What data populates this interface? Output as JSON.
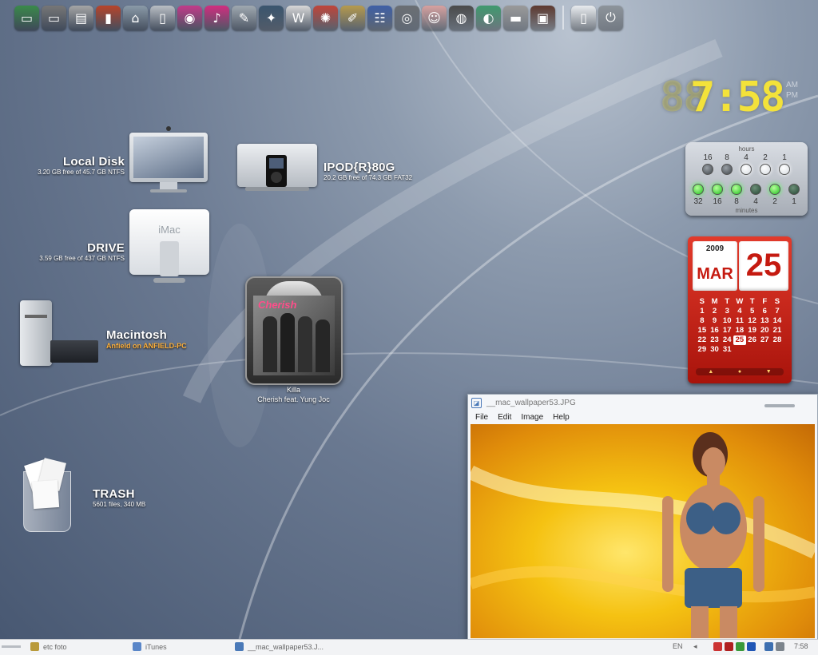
{
  "dock": {
    "icons": [
      {
        "name": "computer-icon",
        "color": "#3a8a4a",
        "glyph": "▭"
      },
      {
        "name": "laptop-icon",
        "color": "#777777",
        "glyph": "▭"
      },
      {
        "name": "printer-icon",
        "color": "#a5a5a5",
        "glyph": "▤"
      },
      {
        "name": "books-icon",
        "color": "#b8442a",
        "glyph": "▮"
      },
      {
        "name": "network-icon",
        "color": "#8a9aa8",
        "glyph": "⌂"
      },
      {
        "name": "mac-pro-icon",
        "color": "#b9bec4",
        "glyph": "▯"
      },
      {
        "name": "ipod-icon",
        "color": "#c33a8a",
        "glyph": "◉"
      },
      {
        "name": "music-icon",
        "color": "#d22d80",
        "glyph": "♪"
      },
      {
        "name": "tools-icon",
        "color": "#9fa8b0",
        "glyph": "✎"
      },
      {
        "name": "compass-icon",
        "color": "#3a556e",
        "glyph": "✦"
      },
      {
        "name": "wikipedia-icon",
        "color": "#d8d8d8",
        "glyph": "W"
      },
      {
        "name": "fox-icon",
        "color": "#c0453a",
        "glyph": "✺"
      },
      {
        "name": "notes-icon",
        "color": "#b59a4d",
        "glyph": "✐"
      },
      {
        "name": "users-icon",
        "color": "#3e5fa6",
        "glyph": "☷"
      },
      {
        "name": "camera-icon",
        "color": "#6b6f74",
        "glyph": "◎"
      },
      {
        "name": "girl-icon",
        "color": "#d7a1a0",
        "glyph": "☺"
      },
      {
        "name": "speaker-icon",
        "color": "#4a4a4a",
        "glyph": "◍"
      },
      {
        "name": "dvd-icon",
        "color": "#3f9a6e",
        "glyph": "◐"
      },
      {
        "name": "scanner-icon",
        "color": "#9a9a9a",
        "glyph": "▬"
      },
      {
        "name": "safe-icon",
        "color": "#5e3a30",
        "glyph": "▣"
      }
    ],
    "trailing_icons": [
      {
        "name": "wii-icon",
        "color": "#e9ecef",
        "glyph": "▯"
      },
      {
        "name": "power-icon",
        "color": "#8d949b",
        "glyph": "⏻"
      }
    ]
  },
  "desktop": {
    "local_disk": {
      "name": "Local Disk",
      "info": "3.20 GB free of 45.7 GB NTFS"
    },
    "ipod": {
      "name": "IPOD{R}80G",
      "info": "20.2 GB free of 74.3 GB FAT32"
    },
    "drive": {
      "name": "DRIVE",
      "info": "3.59 GB free of 437 GB NTFS"
    },
    "macintosh": {
      "name": "Macintosh",
      "info": "Anfield on ANFIELD-PC"
    },
    "trash": {
      "name": "TRASH",
      "info": "5601 files, 340 MB"
    },
    "imac_label": "iMac"
  },
  "album": {
    "title": "Killa",
    "artist": "Cherish feat. Yung Joc",
    "art_text": "Cherish"
  },
  "clock": {
    "ghost": "88",
    "hour": "7",
    "sep": ":",
    "minutes": "58",
    "am": "AM",
    "pm": "PM"
  },
  "binary_clock": {
    "hours_label": "hours",
    "minutes_label": "minutes",
    "hours": [
      {
        "v": "16",
        "on": false
      },
      {
        "v": "8",
        "on": false
      },
      {
        "v": "4",
        "on": true
      },
      {
        "v": "2",
        "on": true
      },
      {
        "v": "1",
        "on": true
      }
    ],
    "minutes": [
      {
        "v": "32",
        "on": true
      },
      {
        "v": "16",
        "on": true
      },
      {
        "v": "8",
        "on": true
      },
      {
        "v": "4",
        "on": false
      },
      {
        "v": "2",
        "on": true
      },
      {
        "v": "1",
        "on": false
      }
    ]
  },
  "calendar": {
    "year": "2009",
    "month": "MAR",
    "day": "25",
    "weekdays": [
      "S",
      "M",
      "T",
      "W",
      "T",
      "F",
      "S"
    ],
    "weeks": [
      [
        "1",
        "2",
        "3",
        "4",
        "5",
        "6",
        "7"
      ],
      [
        "8",
        "9",
        "10",
        "11",
        "12",
        "13",
        "14"
      ],
      [
        "15",
        "16",
        "17",
        "18",
        "19",
        "20",
        "21"
      ],
      [
        "22",
        "23",
        "24",
        "25",
        "26",
        "27",
        "28"
      ],
      [
        "29",
        "30",
        "31",
        "",
        "",
        "",
        ""
      ]
    ],
    "today": "25",
    "nav": [
      "▲",
      "●",
      "▼"
    ]
  },
  "viewer": {
    "title": "__mac_wallpaper53.JPG",
    "menu": [
      "File",
      "Edit",
      "Image",
      "Help"
    ]
  },
  "taskbar": {
    "items": [
      {
        "name": "taskbar-item-etc-foto",
        "label": "etc foto",
        "color": "#b99a3a"
      },
      {
        "name": "taskbar-item-itunes",
        "label": "iTunes",
        "color": "#5a86c8"
      },
      {
        "name": "taskbar-item-viewer",
        "label": "__mac_wallpaper53.J...",
        "color": "#4a79b8"
      }
    ],
    "lang": "EN",
    "time": "7:58"
  }
}
